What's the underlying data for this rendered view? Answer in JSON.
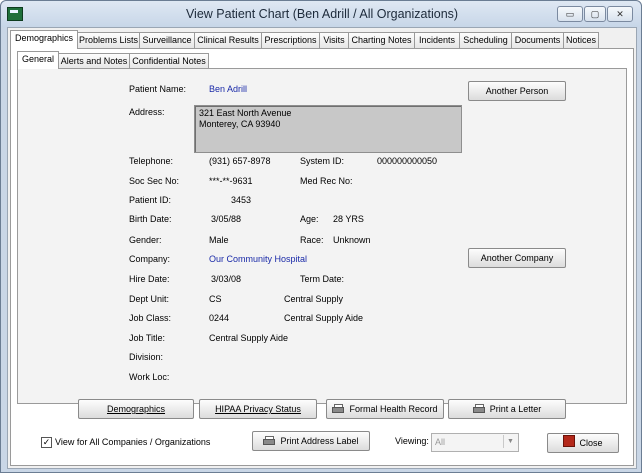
{
  "window": {
    "title": "View Patient Chart (Ben Adrill / All Organizations)",
    "min_glyph": "▭",
    "max_glyph": "▢",
    "close_glyph": "✕"
  },
  "tabs": [
    "Demographics",
    "Problems Lists",
    "Surveillance",
    "Clinical Results",
    "Prescriptions",
    "Visits",
    "Charting Notes",
    "Incidents",
    "Scheduling",
    "Documents",
    "Notices"
  ],
  "subtabs": [
    "General",
    "Alerts and Notes",
    "Confidential Notes"
  ],
  "fields": {
    "patient_name_label": "Patient Name:",
    "patient_name": "Ben Adrill",
    "address_label": "Address:",
    "address_line1": "321 East North Avenue",
    "address_line2": "Monterey, CA  93940",
    "telephone_label": "Telephone:",
    "telephone": "(931) 657-8978",
    "system_id_label": "System ID:",
    "system_id": "000000000050",
    "ssn_label": "Soc Sec No:",
    "ssn": "***-**-9631",
    "medrec_label": "Med Rec No:",
    "patient_id_label": "Patient ID:",
    "patient_id": "3453",
    "birth_label": "Birth Date:",
    "birth": "3/05/88",
    "age_label": "Age:",
    "age": "28 YRS",
    "gender_label": "Gender:",
    "gender": "Male",
    "race_label": "Race:",
    "race": "Unknown",
    "company_label": "Company:",
    "company": "Our Community Hospital",
    "hire_label": "Hire Date:",
    "hire": "3/03/08",
    "term_label": "Term Date:",
    "dept_label": "Dept Unit:",
    "dept_code": "CS",
    "dept_name": "Central Supply",
    "jobclass_label": "Job Class:",
    "jobclass_code": "0244",
    "jobclass_name": "Central Supply Aide",
    "jobtitle_label": "Job Title:",
    "jobtitle": "Central Supply Aide",
    "division_label": "Division:",
    "workloc_label": "Work Loc:"
  },
  "buttons": {
    "another_person": "Another Person",
    "another_company": "Another Company",
    "demographics": "Demographics",
    "hipaa": "HIPAA Privacy Status",
    "formal_health_record": "Formal Health Record",
    "print_letter": "Print a Letter",
    "print_address_label": "Print Address Label",
    "close": "Close"
  },
  "footer": {
    "view_all_label": "View for All Companies / Organizations",
    "view_all_checked": "✓",
    "viewing_label": "Viewing:",
    "viewing_value": "All"
  }
}
